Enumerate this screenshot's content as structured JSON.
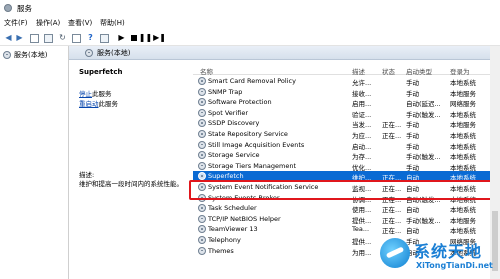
{
  "window": {
    "title": "服务"
  },
  "menu": [
    "文件(F)",
    "操作(A)",
    "查看(V)",
    "帮助(H)"
  ],
  "tree": {
    "root_label": "服务(本地)"
  },
  "main": {
    "header": "服务(本地)"
  },
  "detail": {
    "service_name": "Superfetch",
    "stop_link": "停止",
    "stop_suffix": "此服务",
    "restart_link": "重启动",
    "restart_suffix": "此服务",
    "desc_label": "描述:",
    "desc_text": "维护和提高一段时间内的系统性能。"
  },
  "list": {
    "columns": {
      "name": "名称",
      "desc": "描述",
      "status": "状态",
      "startup": "启动类型",
      "logon": "登录为"
    },
    "rows": [
      {
        "name": "Smart Card Removal Policy",
        "desc": "允许...",
        "status": "",
        "startup": "手动",
        "logon": "本地系统"
      },
      {
        "name": "SNMP Trap",
        "desc": "接收...",
        "status": "",
        "startup": "手动",
        "logon": "本地服务"
      },
      {
        "name": "Software Protection",
        "desc": "启用...",
        "status": "",
        "startup": "自动(延迟...",
        "logon": "网络服务"
      },
      {
        "name": "Spot Verifier",
        "desc": "验证...",
        "status": "",
        "startup": "手动(触发...",
        "logon": "本地系统"
      },
      {
        "name": "SSDP Discovery",
        "desc": "当发...",
        "status": "正在...",
        "startup": "手动",
        "logon": "本地服务"
      },
      {
        "name": "State Repository Service",
        "desc": "为应...",
        "status": "正在...",
        "startup": "手动",
        "logon": "本地系统"
      },
      {
        "name": "Still Image Acquisition Events",
        "desc": "启动...",
        "status": "",
        "startup": "手动",
        "logon": "本地系统"
      },
      {
        "name": "Storage Service",
        "desc": "为存...",
        "status": "",
        "startup": "手动(触发...",
        "logon": "本地系统"
      },
      {
        "name": "Storage Tiers Management",
        "desc": "优化...",
        "status": "",
        "startup": "手动",
        "logon": "本地系统"
      },
      {
        "name": "Superfetch",
        "desc": "维护...",
        "status": "正在...",
        "startup": "自动",
        "logon": "本地系统",
        "selected": true
      },
      {
        "name": "System Event Notification Service",
        "desc": "监视...",
        "status": "正在...",
        "startup": "自动",
        "logon": "本地系统"
      },
      {
        "name": "System Events Broker",
        "desc": "协调...",
        "status": "正在...",
        "startup": "自动(触发...",
        "logon": "本地系统"
      },
      {
        "name": "Task Scheduler",
        "desc": "使用...",
        "status": "正在...",
        "startup": "自动",
        "logon": "本地系统"
      },
      {
        "name": "TCP/IP NetBIOS Helper",
        "desc": "提供...",
        "status": "正在...",
        "startup": "手动(触发...",
        "logon": "本地服务"
      },
      {
        "name": "TeamViewer 13",
        "desc": "Tea...",
        "status": "正在...",
        "startup": "自动",
        "logon": "本地系统"
      },
      {
        "name": "Telephony",
        "desc": "提供...",
        "status": "",
        "startup": "手动",
        "logon": "网络服务"
      },
      {
        "name": "Themes",
        "desc": "为用...",
        "status": "正在...",
        "startup": "自动",
        "logon": "本地系统"
      }
    ]
  },
  "watermark": {
    "cn": "系统天地",
    "en": "XiTongTianDi.net"
  }
}
